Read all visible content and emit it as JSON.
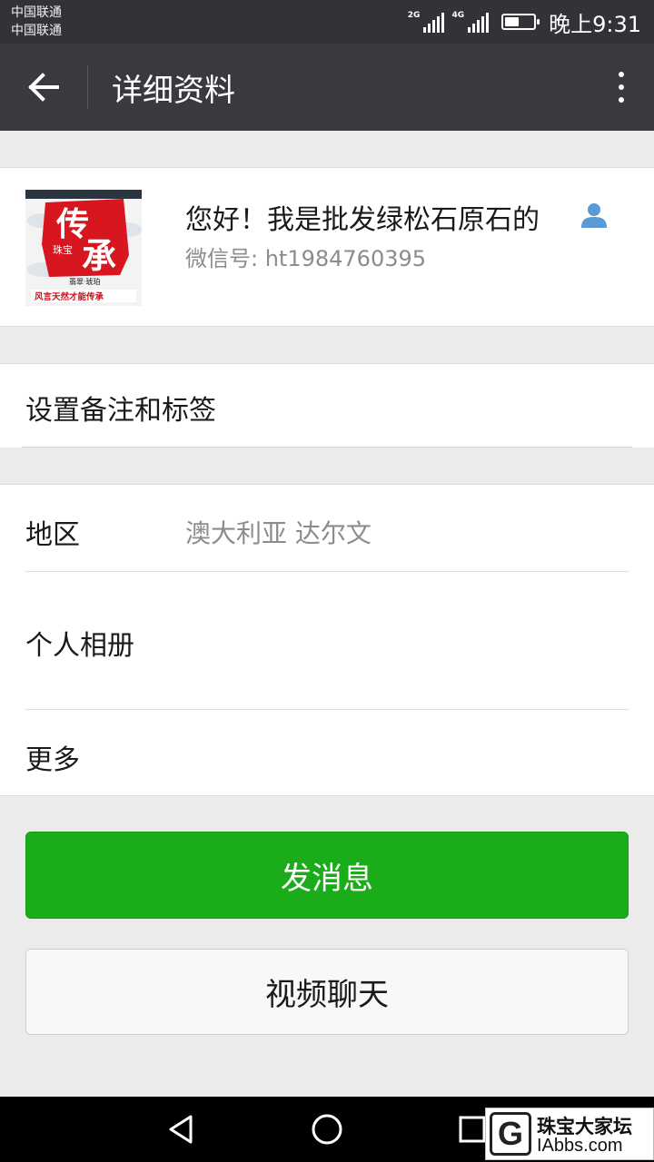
{
  "status_bar": {
    "carrier_1": "中国联通",
    "carrier_2": "中国联通",
    "net_1": "2G",
    "net_2": "4G",
    "battery_level": 0.5,
    "time": "晚上9:31"
  },
  "app_bar": {
    "back_icon": "arrow-left-icon",
    "title": "详细资料",
    "more_icon": "more-vertical-icon"
  },
  "profile": {
    "name": "您好！我是批发绿松石原石的",
    "wechat_id": "微信号: ht1984760395",
    "contact_icon": "contact-person-icon",
    "avatar_text": {
      "big_1": "传",
      "big_2": "承",
      "small": "珠宝",
      "line_1": "翡翠·琥珀",
      "line_2": "风言天然才能传承"
    }
  },
  "remark": {
    "label": "设置备注和标签"
  },
  "info": {
    "region_label": "地区",
    "region_value": "澳大利亚  达尔文",
    "album_label": "个人相册",
    "more_label": "更多"
  },
  "actions": {
    "send_message": "发消息",
    "video_chat": "视频聊天"
  },
  "nav_bar": {
    "back_icon": "triangle-back-icon",
    "home_icon": "circle-home-icon",
    "recents_icon": "square-recents-icon"
  },
  "watermark": {
    "logo_letter": "G",
    "site_name": "珠宝大家坛",
    "site_url": "IAbbs.com"
  },
  "colors": {
    "status_bar": "#323337",
    "app_bar": "#393a3f",
    "primary_button": "#1aad19",
    "background": "#ebebeb",
    "contact_icon": "#5b9bd5"
  }
}
